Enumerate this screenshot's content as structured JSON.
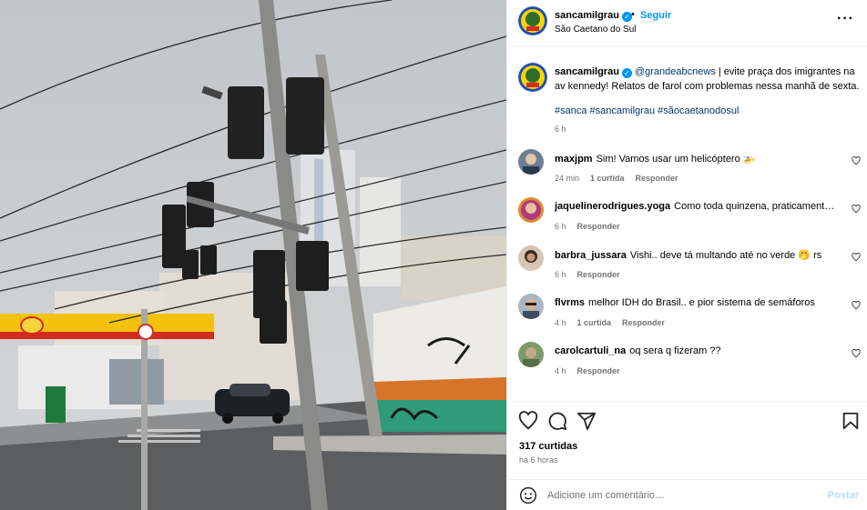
{
  "post": {
    "username": "sancamilgrau",
    "follow_label": "Seguir",
    "dot": "•",
    "location": "São Caetano do Sul",
    "more_icon": "more-horizontal-icon"
  },
  "caption": {
    "username": "sancamilgrau",
    "mention": "@grandeabcnews",
    "text": " | evite praça dos imigrantes na av kennedy! Relatos de farol com problemas nessa manhã de sexta.",
    "hashtags": "#sanca #sancamilgrau #sãocaetanodosul",
    "time": "6 h"
  },
  "comments": [
    {
      "user": "maxjpm",
      "text": "Sim! Vamos usar um helicóptero 🚁",
      "time": "24 min",
      "likes": "1 curtida",
      "reply": "Responder"
    },
    {
      "user": "jaquelinerodrigues.yoga",
      "text": "Como toda quinzena, praticamente…",
      "time": "6 h",
      "likes": "",
      "reply": "Responder"
    },
    {
      "user": "barbra_jussara",
      "text": "Vishi.. deve tá multando até no verde 🤭 rs",
      "time": "6 h",
      "likes": "",
      "reply": "Responder"
    },
    {
      "user": "flvrms",
      "text": "melhor IDH do Brasil.. e pior sistema de semáforos",
      "time": "4 h",
      "likes": "1 curtida",
      "reply": "Responder"
    },
    {
      "user": "carolcartuli_na",
      "text": "oq sera q fizeram ??",
      "time": "4 h",
      "likes": "",
      "reply": "Responder"
    }
  ],
  "footer": {
    "likes": "317 curtidas",
    "ago": "há 6 horas",
    "comment_placeholder": "Adicione um comentário…",
    "post_label": "Postar"
  },
  "icons": {
    "like": "heart-icon",
    "comment": "comment-icon",
    "share": "share-icon",
    "save": "bookmark-icon",
    "emoji": "emoji-icon"
  },
  "colors": {
    "link": "#0095f6",
    "mention": "#00376b",
    "muted": "#737373",
    "post_disabled": "#b2dffc",
    "shell_yellow": "#f4c20d",
    "shell_red": "#d52b1e"
  }
}
